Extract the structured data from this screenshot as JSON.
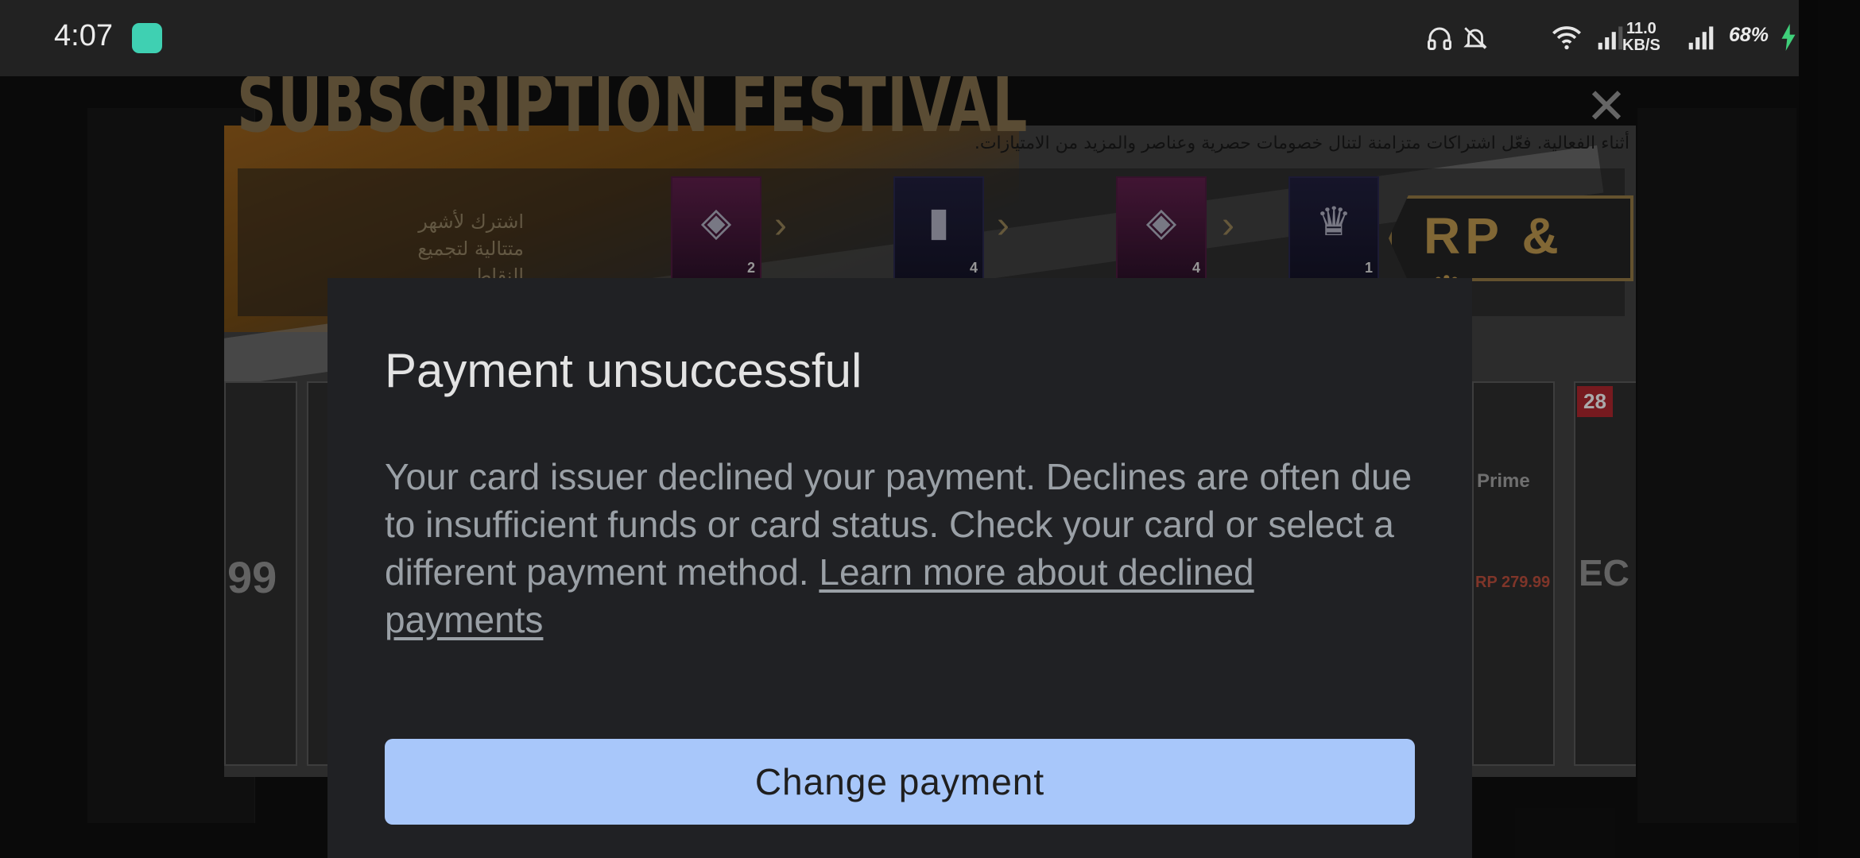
{
  "status_bar": {
    "time": "4:07",
    "speed_value": "11.0",
    "speed_unit": "KB/S",
    "battery": "68%",
    "icons": [
      "headset-icon",
      "bell-off-icon",
      "wifi-icon",
      "signal-icon",
      "signal-icon",
      "charging-icon"
    ]
  },
  "game": {
    "title": "SUBSCRIPTION FESTIVAL",
    "close_glyph": "✕",
    "description": "أثناء الفعالية. فعّل اشتراكات متزامنة لتنال خصومات حصرية وعناصر والمزيد من الامتيازات.",
    "reward_text": "اشترك لأشهر متتالية لتجميع النقاط",
    "rewards": [
      {
        "qty": "2"
      },
      {
        "qty": "4"
      },
      {
        "qty": "4"
      },
      {
        "qty": "1"
      }
    ],
    "badge": "RP & ♛",
    "cards": {
      "left_price": "99",
      "right_name": "Prime",
      "right_strike": "RP 279.99",
      "far_right_tag": "28",
      "far_right_text": "EC"
    }
  },
  "dialog": {
    "title": "Payment unsuccessful",
    "body": "Your card issuer declined your payment. Declines are often due to insufficient funds or card status. Check your card or select a different payment method. ",
    "link": "Learn more about declined payments",
    "button": "Change payment"
  },
  "colors": {
    "dialog_bg": "#202124",
    "button_bg": "#a8c7fa",
    "status_bar_bg": "#222222"
  }
}
